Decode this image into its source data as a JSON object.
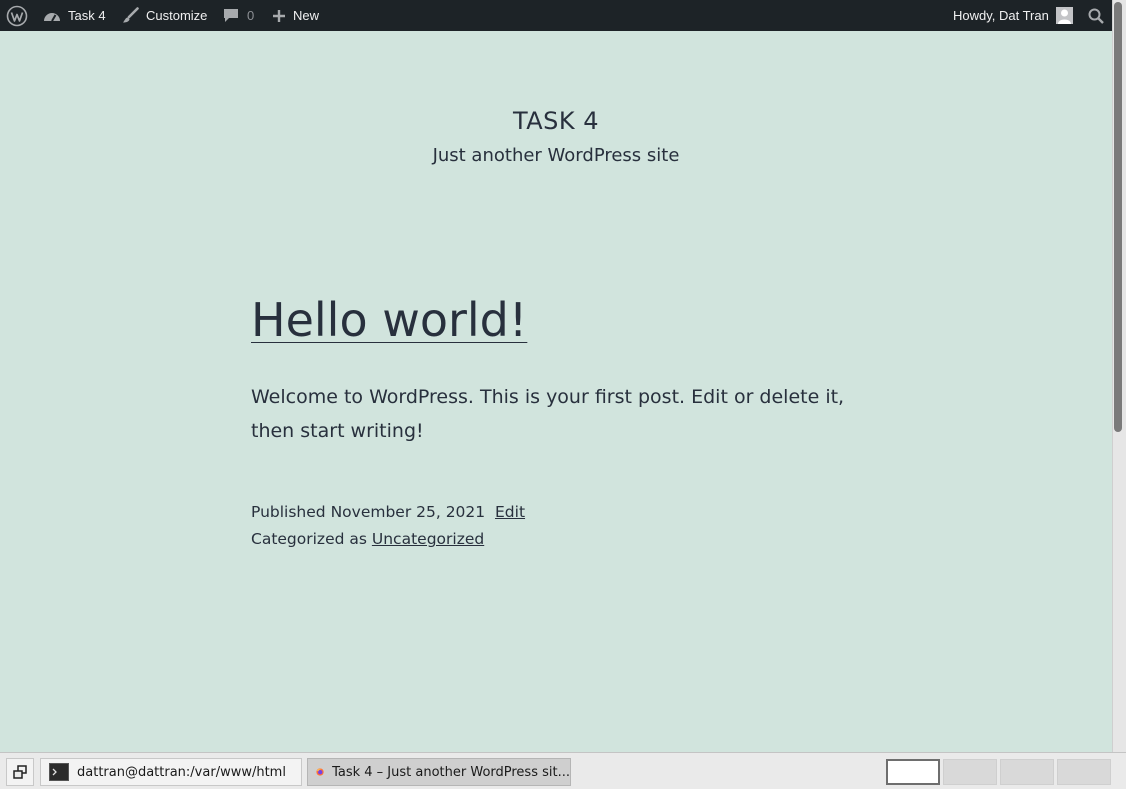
{
  "adminbar": {
    "site_name": "Task 4",
    "customize": "Customize",
    "comments_count": "0",
    "new": "New",
    "howdy": "Howdy, Dat Tran"
  },
  "site": {
    "title": "TASK 4",
    "description": "Just another WordPress site"
  },
  "post": {
    "title": "Hello world!",
    "body": "Welcome to WordPress. This is your first post. Edit or delete it, then start writing!",
    "published_label": "Published",
    "date": "November 25, 2021",
    "edit": "Edit",
    "categorized_label": "Categorized as",
    "category": "Uncategorized"
  },
  "taskbar": {
    "terminal_title": "dattran@dattran:/var/www/html",
    "browser_title": "Task 4 – Just another WordPress sit..."
  }
}
